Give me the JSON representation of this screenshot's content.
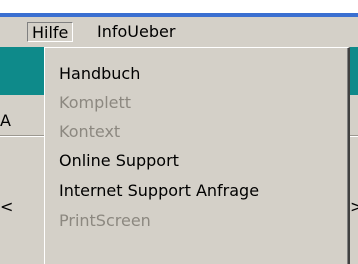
{
  "menubar": {
    "items": [
      {
        "label": "Hilfe"
      },
      {
        "label": "InfoUeber"
      }
    ]
  },
  "dropdown": {
    "items": [
      {
        "label": "Handbuch",
        "enabled": true
      },
      {
        "label": "Komplett",
        "enabled": false
      },
      {
        "label": "Kontext",
        "enabled": false
      },
      {
        "label": "Online Support",
        "enabled": true
      },
      {
        "label": "Internet Support Anfrage",
        "enabled": true
      },
      {
        "label": "PrintScreen",
        "enabled": false
      }
    ]
  },
  "background": {
    "left_edge_glyphs": [
      "A",
      "<"
    ],
    "right_edge_glyphs": [
      ">"
    ]
  },
  "colors": {
    "menu_face": "#d4d0c8",
    "teal_band": "#0e8a8a",
    "title_accent": "#3a6fd1",
    "disabled_text": "#8c8880"
  }
}
